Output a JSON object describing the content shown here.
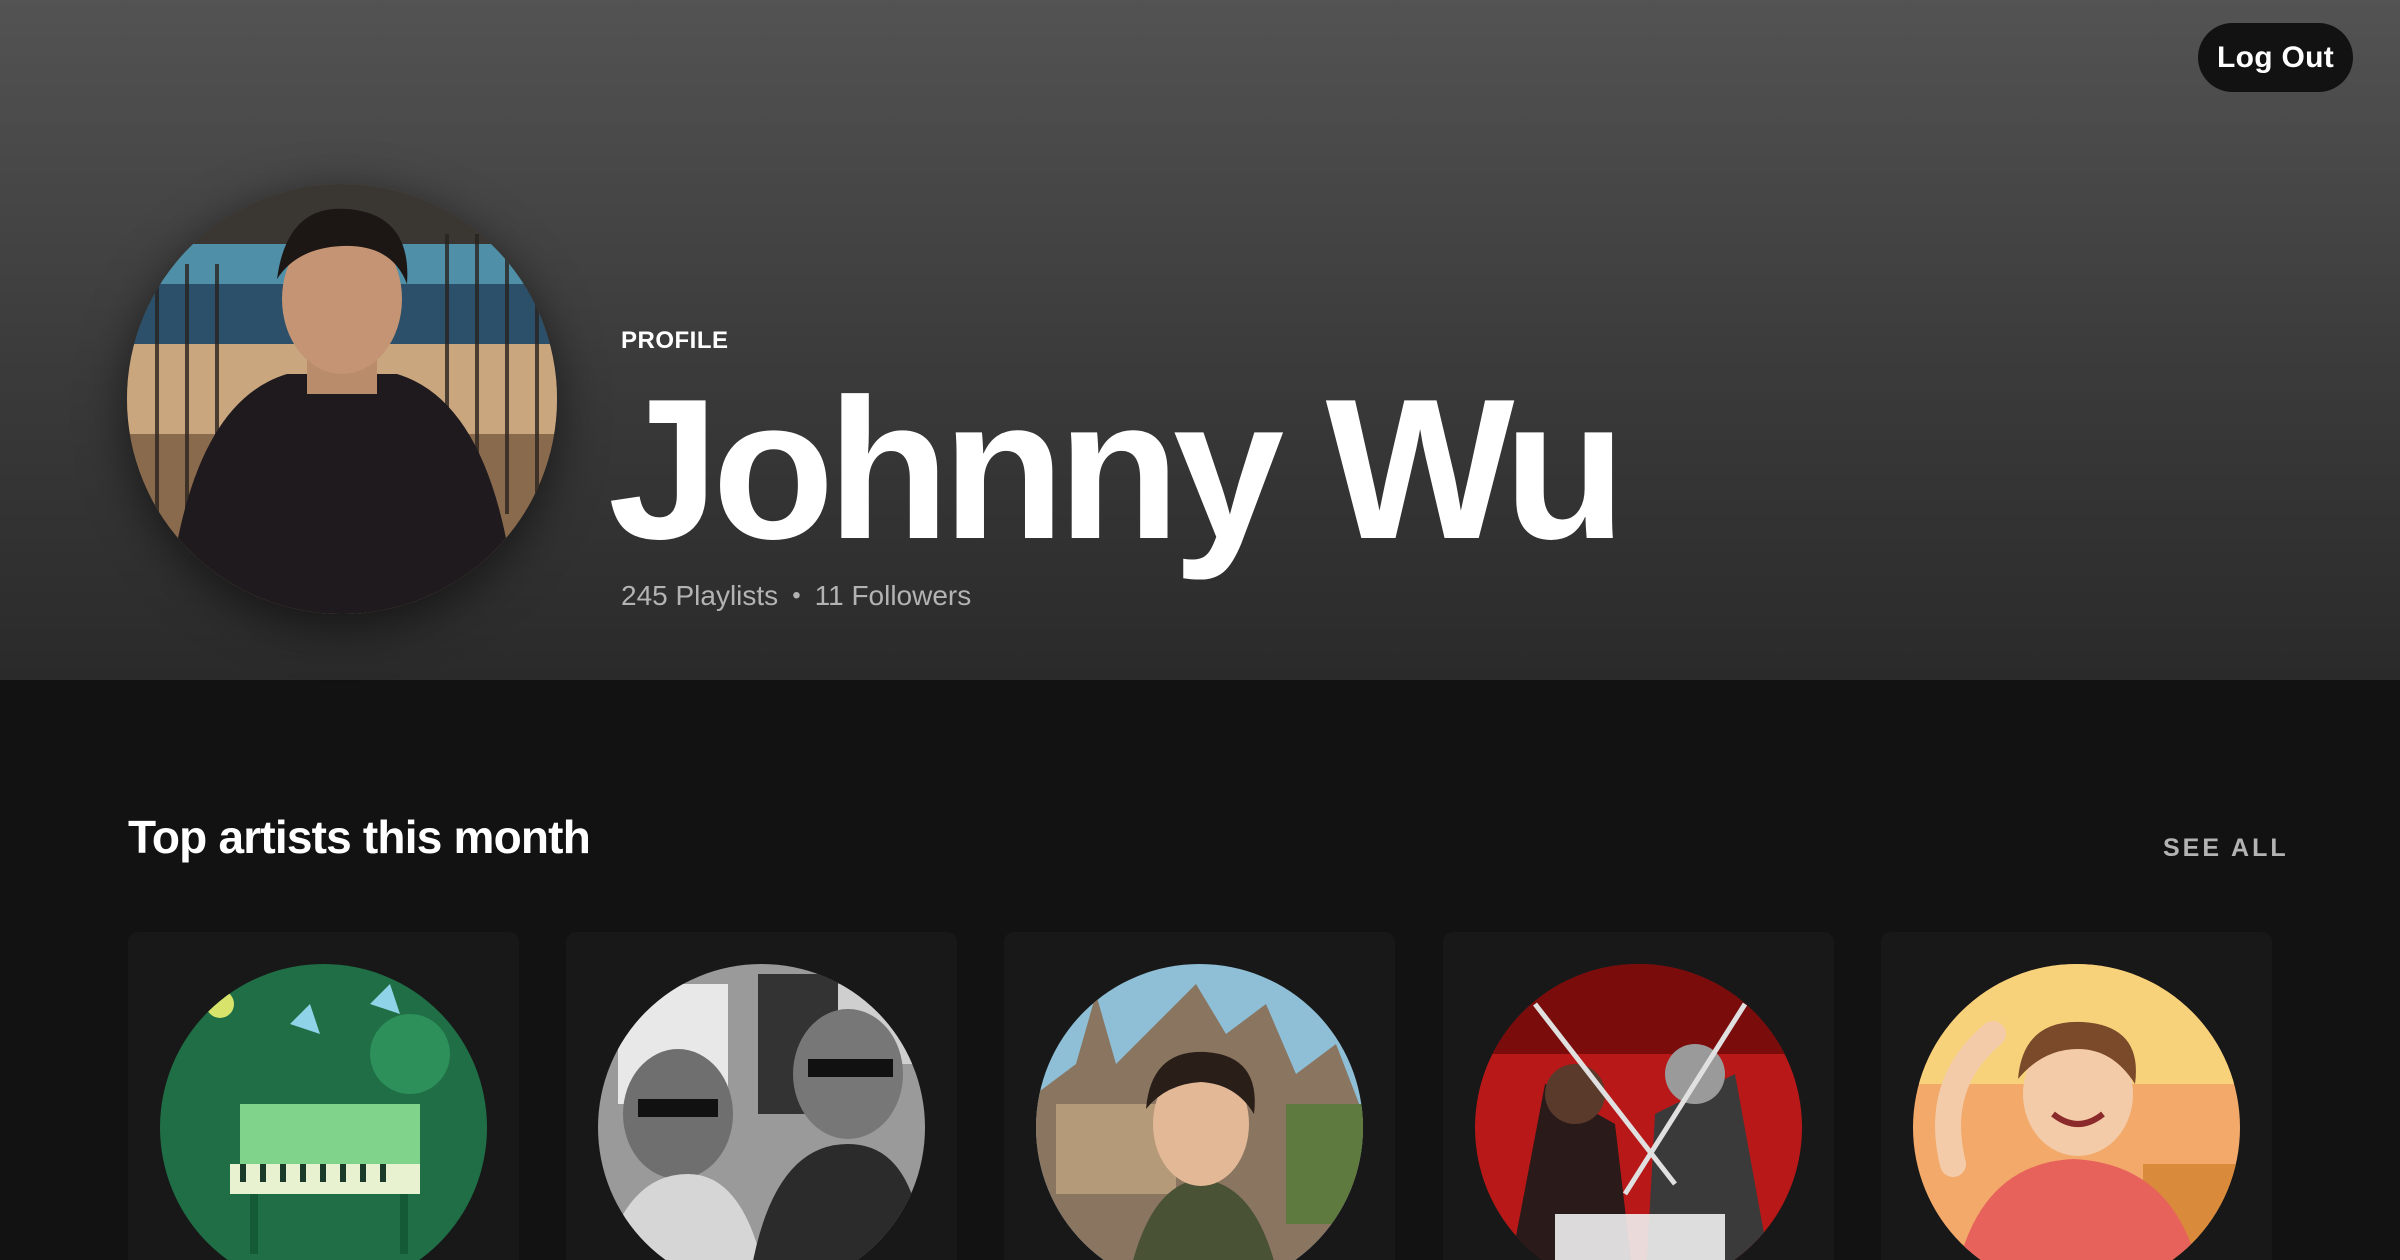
{
  "header": {
    "logout_label": "Log Out",
    "profile_label": "PROFILE",
    "user_name": "Johnny Wu",
    "playlists": "245 Playlists",
    "separator": "•",
    "followers": "11 Followers"
  },
  "top_artists": {
    "title": "Top artists this month",
    "see_all_label": "SEE ALL",
    "items": [
      {
        "image": "green-piano-artwork"
      },
      {
        "image": "two-men-sunglasses-bw-photo"
      },
      {
        "image": "man-castle-photo"
      },
      {
        "image": "red-warriors-artwork"
      },
      {
        "image": "anime-character-artwork"
      }
    ]
  },
  "colors": {
    "background": "#121212",
    "card": "#181818",
    "header_top": "#535353",
    "muted_text": "#b3b3b3"
  }
}
